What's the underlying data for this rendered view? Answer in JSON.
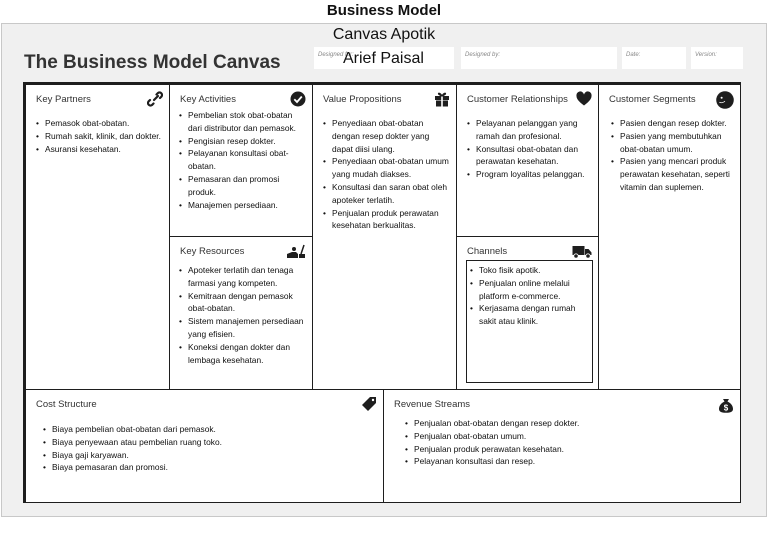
{
  "page": {
    "heading": "Business Model",
    "doc_title": "Canvas Apotik"
  },
  "header": {
    "canvas_title": "The Business Model Canvas",
    "designed_for_label": "Designed for:",
    "designed_for_value": "Arief Paisal",
    "designed_by_label": "Designed by:",
    "date_label": "Date:",
    "version_label": "Version:"
  },
  "cells": {
    "key_partners": {
      "title": "Key Partners",
      "icon": "link-icon",
      "items": [
        "Pemasok obat-obatan.",
        "Rumah sakit, klinik, dan dokter.",
        "Asuransi kesehatan."
      ]
    },
    "key_activities": {
      "title": "Key Activities",
      "icon": "checkmark-icon",
      "items": [
        "Pembelian stok obat-obatan dari distributor dan pemasok.",
        "Pengisian resep dokter.",
        "Pelayanan konsultasi obat-obatan.",
        "Pemasaran dan promosi produk.",
        "Manajemen persediaan."
      ]
    },
    "key_resources": {
      "title": "Key Resources",
      "icon": "worker-icon",
      "items": [
        "Apoteker terlatih dan tenaga farmasi yang kompeten.",
        "Kemitraan dengan pemasok obat-obatan.",
        "Sistem manajemen persediaan yang efisien.",
        "Koneksi dengan dokter dan lembaga kesehatan."
      ]
    },
    "value_propositions": {
      "title": "Value Propositions",
      "icon": "gift-icon",
      "items": [
        "Penyediaan obat-obatan dengan resep dokter yang dapat diisi ulang.",
        "Penyediaan obat-obatan umum yang mudah diakses.",
        "Konsultasi dan saran obat oleh apoteker terlatih.",
        "Penjualan produk perawatan kesehatan berkualitas."
      ]
    },
    "customer_relationships": {
      "title": "Customer Relationships",
      "icon": "heart-icon",
      "items": [
        "Pelayanan pelanggan yang ramah dan profesional.",
        "Konsultasi obat-obatan dan perawatan kesehatan.",
        "Program loyalitas pelanggan."
      ]
    },
    "channels": {
      "title": "Channels",
      "icon": "truck-icon",
      "items": [
        "Toko fisik apotik.",
        "Penjualan online melalui platform e-commerce.",
        "Kerjasama dengan rumah sakit atau klinik."
      ]
    },
    "customer_segments": {
      "title": "Customer Segments",
      "icon": "person-icon",
      "items": [
        "Pasien dengan resep dokter.",
        "Pasien yang membutuhkan obat-obatan umum.",
        "Pasien yang mencari produk perawatan kesehatan, seperti vitamin dan suplemen."
      ]
    },
    "cost_structure": {
      "title": "Cost Structure",
      "icon": "price-tag-icon",
      "items": [
        "Biaya pembelian obat-obatan dari pemasok.",
        "Biaya penyewaan atau pembelian ruang toko.",
        "Biaya gaji karyawan.",
        "Biaya pemasaran dan promosi."
      ]
    },
    "revenue_streams": {
      "title": "Revenue Streams",
      "icon": "money-bag-icon",
      "items": [
        "Penjualan obat-obatan dengan resep dokter.",
        "Penjualan obat-obatan umum.",
        "Penjualan produk perawatan kesehatan.",
        "Pelayanan konsultasi dan resep."
      ]
    }
  }
}
